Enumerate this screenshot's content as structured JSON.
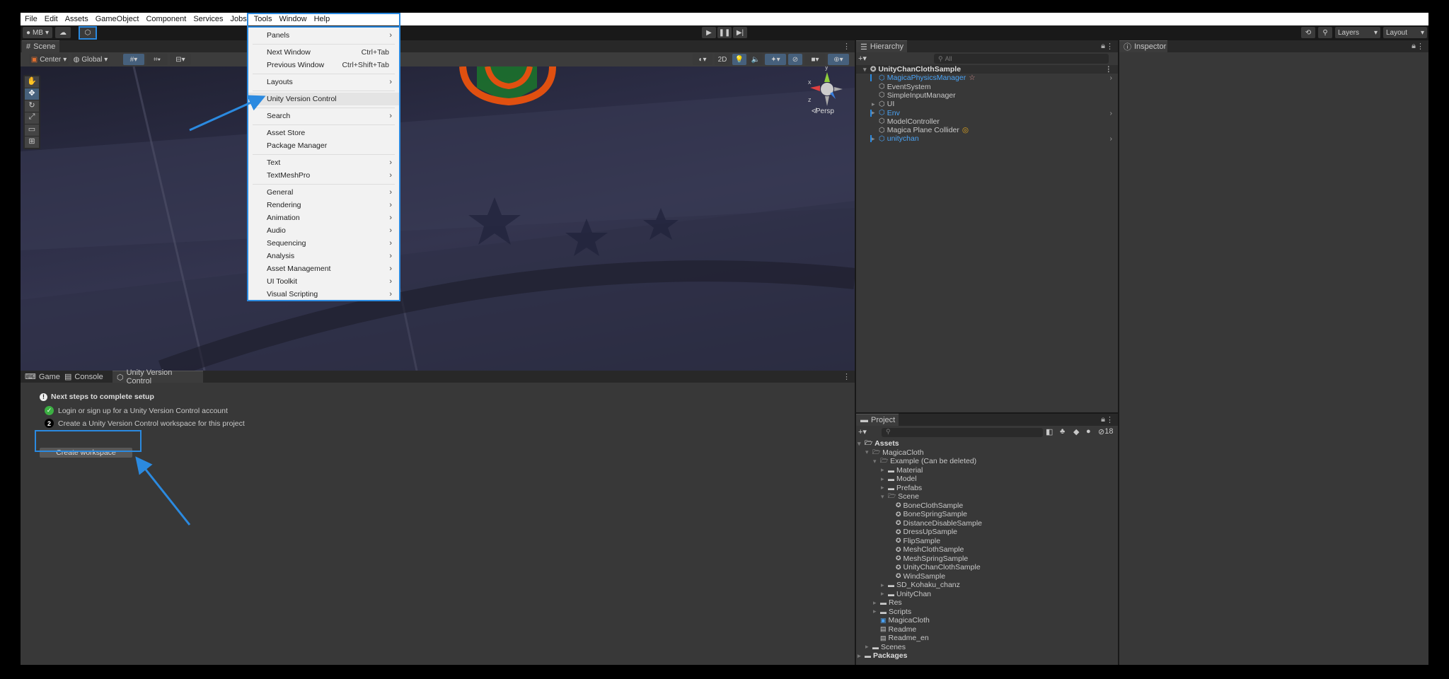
{
  "menubar": [
    "File",
    "Edit",
    "Assets",
    "GameObject",
    "Component",
    "Services",
    "Jobs",
    "Tools",
    "Window",
    "Help"
  ],
  "toolbar": {
    "account": "MB",
    "layers": "Layers",
    "layout": "Layout"
  },
  "scene": {
    "tab": "Scene",
    "pivot": "Center",
    "space": "Global",
    "mode2d": "2D",
    "persp": "Persp",
    "gizmo_axes": [
      "y",
      "x",
      "z"
    ]
  },
  "window_menu": {
    "groups": [
      [
        {
          "label": "Panels",
          "sub": true
        }
      ],
      [
        {
          "label": "Next Window",
          "shortcut": "Ctrl+Tab"
        },
        {
          "label": "Previous Window",
          "shortcut": "Ctrl+Shift+Tab"
        }
      ],
      [
        {
          "label": "Layouts",
          "sub": true
        }
      ],
      [
        {
          "label": "Unity Version Control",
          "highlighted": true
        }
      ],
      [
        {
          "label": "Search",
          "sub": true
        }
      ],
      [
        {
          "label": "Asset Store"
        },
        {
          "label": "Package Manager"
        }
      ],
      [
        {
          "label": "Text",
          "sub": true
        },
        {
          "label": "TextMeshPro",
          "sub": true
        }
      ],
      [
        {
          "label": "General",
          "sub": true
        },
        {
          "label": "Rendering",
          "sub": true
        },
        {
          "label": "Animation",
          "sub": true
        },
        {
          "label": "Audio",
          "sub": true
        },
        {
          "label": "Sequencing",
          "sub": true
        },
        {
          "label": "Analysis",
          "sub": true
        },
        {
          "label": "Asset Management",
          "sub": true
        },
        {
          "label": "UI Toolkit",
          "sub": true
        },
        {
          "label": "Visual Scripting",
          "sub": true
        }
      ]
    ]
  },
  "bottom": {
    "tabs": [
      "Game",
      "Console",
      "Unity Version Control"
    ],
    "heading": "Next steps to complete setup",
    "step1": "Login or sign up for a Unity Version Control account",
    "step2_num": "2",
    "step2": "Create a Unity Version Control workspace for this project",
    "button": "Create workspace"
  },
  "hierarchy": {
    "title": "Hierarchy",
    "search_placeholder": "All",
    "items": [
      {
        "label": "UnityChanClothSample",
        "depth": 0,
        "type": "scene",
        "expanded": true
      },
      {
        "label": "MagicaPhysicsManager",
        "depth": 1,
        "type": "prefab",
        "badge": "star"
      },
      {
        "label": "EventSystem",
        "depth": 1
      },
      {
        "label": "SimpleInputManager",
        "depth": 1
      },
      {
        "label": "UI",
        "depth": 1,
        "collapsed": true
      },
      {
        "label": "Env",
        "depth": 1,
        "type": "prefab",
        "collapsed": true
      },
      {
        "label": "ModelController",
        "depth": 1
      },
      {
        "label": "Magica Plane Collider",
        "depth": 1,
        "badge": "target"
      },
      {
        "label": "unitychan",
        "depth": 1,
        "type": "prefab",
        "collapsed": true
      }
    ]
  },
  "inspector": {
    "title": "Inspector"
  },
  "project": {
    "title": "Project",
    "hidden_count": "18",
    "items": [
      {
        "label": "Assets",
        "depth": 0,
        "type": "folder-open",
        "bold": true
      },
      {
        "label": "MagicaCloth",
        "depth": 1,
        "type": "folder-open"
      },
      {
        "label": "Example (Can be deleted)",
        "depth": 2,
        "type": "folder-open"
      },
      {
        "label": "Material",
        "depth": 3,
        "type": "folder"
      },
      {
        "label": "Model",
        "depth": 3,
        "type": "folder"
      },
      {
        "label": "Prefabs",
        "depth": 3,
        "type": "folder"
      },
      {
        "label": "Scene",
        "depth": 3,
        "type": "folder-open"
      },
      {
        "label": "BoneClothSample",
        "depth": 4,
        "type": "scene"
      },
      {
        "label": "BoneSpringSample",
        "depth": 4,
        "type": "scene"
      },
      {
        "label": "DistanceDisableSample",
        "depth": 4,
        "type": "scene"
      },
      {
        "label": "DressUpSample",
        "depth": 4,
        "type": "scene"
      },
      {
        "label": "FlipSample",
        "depth": 4,
        "type": "scene"
      },
      {
        "label": "MeshClothSample",
        "depth": 4,
        "type": "scene"
      },
      {
        "label": "MeshSpringSample",
        "depth": 4,
        "type": "scene"
      },
      {
        "label": "UnityChanClothSample",
        "depth": 4,
        "type": "scene"
      },
      {
        "label": "WindSample",
        "depth": 4,
        "type": "scene"
      },
      {
        "label": "SD_Kohaku_chanz",
        "depth": 3,
        "type": "folder"
      },
      {
        "label": "UnityChan",
        "depth": 3,
        "type": "folder"
      },
      {
        "label": "Res",
        "depth": 2,
        "type": "folder"
      },
      {
        "label": "Scripts",
        "depth": 2,
        "type": "folder"
      },
      {
        "label": "MagicaCloth",
        "depth": 2,
        "type": "asset"
      },
      {
        "label": "Readme",
        "depth": 2,
        "type": "file"
      },
      {
        "label": "Readme_en",
        "depth": 2,
        "type": "file"
      },
      {
        "label": "Scenes",
        "depth": 1,
        "type": "folder"
      },
      {
        "label": "Packages",
        "depth": 0,
        "type": "folder",
        "bold": true
      }
    ]
  },
  "colors": {
    "accent": "#2b8ae0",
    "prefab": "#4aa3f5",
    "success": "#3cb043"
  }
}
